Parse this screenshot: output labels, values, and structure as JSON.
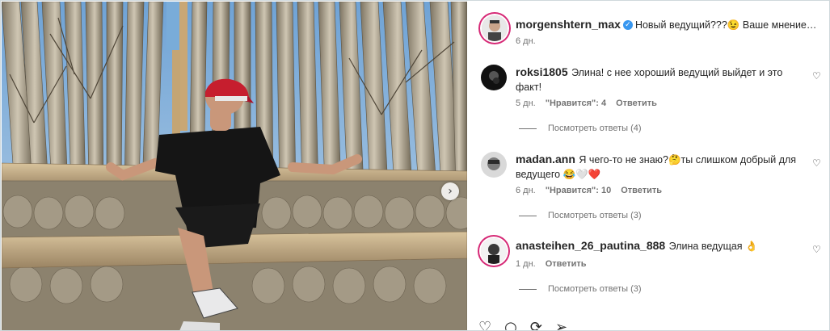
{
  "post": {
    "author": "morgenshtern_max",
    "caption": "Новый ведущий???😉 Ваше мнение…",
    "time": "6 дн."
  },
  "comments": [
    {
      "user": "roksi1805",
      "text": "Элина! с нее хороший ведущий выйдет и это факт!",
      "time": "5 дн.",
      "likes": "\"Нравится\": 4",
      "reply": "Ответить",
      "view_replies": "Посмотреть ответы (4)"
    },
    {
      "user": "madan.ann",
      "text": "Я чего-то не знаю?🤔ты слишком добрый для ведущего 😂🤍❤️",
      "time": "6 дн.",
      "likes": "\"Нравится\": 10",
      "reply": "Ответить",
      "view_replies": "Посмотреть ответы (3)"
    },
    {
      "user": "anasteihen_26_pautina_888",
      "text": "Элина ведущая 👌",
      "time": "1 дн.",
      "reply": "Ответить",
      "view_replies": "Посмотреть ответы (3)"
    }
  ],
  "icons": {
    "verified": "verified-badge-icon",
    "like": "heart-icon",
    "next": "chevron-right-icon",
    "actions": [
      "heart-icon",
      "comment-icon",
      "share-icon",
      "send-icon"
    ]
  },
  "colors": {
    "verified": "#3897f0",
    "story_ring": "#d62976",
    "muted": "#737373"
  }
}
